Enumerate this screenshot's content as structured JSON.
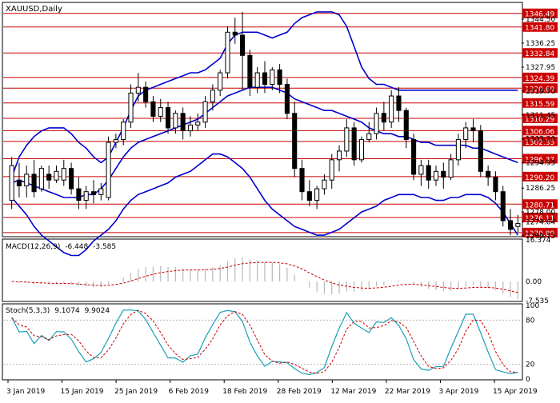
{
  "chart_data": {
    "type": "candlestick",
    "title": "XAUUSD,Daily",
    "x_tick_labels": [
      "3 Jan 2019",
      "15 Jan 2019",
      "25 Jan 2019",
      "6 Feb 2019",
      "18 Feb 2019",
      "28 Feb 2019",
      "12 Mar 2019",
      "22 Mar 2019",
      "3 Apr 2019",
      "15 Apr 2019"
    ],
    "price_axis": {
      "ylim": [
        1269.75,
        1350.0
      ],
      "tick_labels": [
        "1344.50",
        "1336.25",
        "1327.95",
        "1319.70",
        "1311.45",
        "1303.20",
        "1294.95",
        "1286.25",
        "1278.00",
        "1274.64",
        "1269.75"
      ],
      "level_labels": [
        "1346.49",
        "1341.80",
        "1332.84",
        "1324.39",
        "1320.69",
        "1315.59",
        "1310.29",
        "1306.06",
        "1302.33",
        "1296.37",
        "1290.20",
        "1280.71",
        "1276.11",
        "1270.89"
      ]
    },
    "candles": [
      {
        "o": 1282,
        "h": 1297,
        "c": 1294,
        "l": 1279
      },
      {
        "o": 1289,
        "h": 1295,
        "c": 1287,
        "l": 1283
      },
      {
        "o": 1287,
        "h": 1294,
        "c": 1291,
        "l": 1283
      },
      {
        "o": 1291,
        "h": 1296,
        "c": 1285,
        "l": 1283
      },
      {
        "o": 1286,
        "h": 1294,
        "c": 1293,
        "l": 1285
      },
      {
        "o": 1291,
        "h": 1294,
        "c": 1289,
        "l": 1286
      },
      {
        "o": 1289,
        "h": 1294,
        "c": 1292,
        "l": 1288
      },
      {
        "o": 1289,
        "h": 1296,
        "c": 1293,
        "l": 1287
      },
      {
        "o": 1293,
        "h": 1295,
        "c": 1286,
        "l": 1284
      },
      {
        "o": 1286,
        "h": 1290,
        "c": 1282,
        "l": 1279
      },
      {
        "o": 1282,
        "h": 1287,
        "c": 1285,
        "l": 1279
      },
      {
        "o": 1285,
        "h": 1289,
        "c": 1284,
        "l": 1281
      },
      {
        "o": 1284,
        "h": 1288,
        "c": 1286,
        "l": 1282
      },
      {
        "o": 1283,
        "h": 1304,
        "c": 1302,
        "l": 1282
      },
      {
        "o": 1302,
        "h": 1305,
        "c": 1303,
        "l": 1300
      },
      {
        "o": 1303,
        "h": 1310,
        "c": 1309,
        "l": 1301
      },
      {
        "o": 1309,
        "h": 1322,
        "c": 1319,
        "l": 1307
      },
      {
        "o": 1319,
        "h": 1326,
        "c": 1321,
        "l": 1316
      },
      {
        "o": 1321,
        "h": 1323,
        "c": 1316,
        "l": 1314
      },
      {
        "o": 1316,
        "h": 1318,
        "c": 1311,
        "l": 1309
      },
      {
        "o": 1311,
        "h": 1317,
        "c": 1314,
        "l": 1309
      },
      {
        "o": 1314,
        "h": 1316,
        "c": 1307,
        "l": 1305
      },
      {
        "o": 1307,
        "h": 1313,
        "c": 1312,
        "l": 1305
      },
      {
        "o": 1312,
        "h": 1314,
        "c": 1306,
        "l": 1303
      },
      {
        "o": 1306,
        "h": 1311,
        "c": 1308,
        "l": 1304
      },
      {
        "o": 1308,
        "h": 1312,
        "c": 1309,
        "l": 1306
      },
      {
        "o": 1309,
        "h": 1318,
        "c": 1316,
        "l": 1307
      },
      {
        "o": 1316,
        "h": 1322,
        "c": 1320,
        "l": 1313
      },
      {
        "o": 1320,
        "h": 1327,
        "c": 1326,
        "l": 1318
      },
      {
        "o": 1326,
        "h": 1342,
        "c": 1340,
        "l": 1324
      },
      {
        "o": 1340,
        "h": 1345,
        "c": 1339,
        "l": 1336
      },
      {
        "o": 1339,
        "h": 1347,
        "c": 1332,
        "l": 1320
      },
      {
        "o": 1332,
        "h": 1334,
        "c": 1321,
        "l": 1318
      },
      {
        "o": 1321,
        "h": 1328,
        "c": 1326,
        "l": 1319
      },
      {
        "o": 1326,
        "h": 1330,
        "c": 1322,
        "l": 1319
      },
      {
        "o": 1322,
        "h": 1328,
        "c": 1327,
        "l": 1320
      },
      {
        "o": 1327,
        "h": 1329,
        "c": 1322,
        "l": 1319
      },
      {
        "o": 1322,
        "h": 1324,
        "c": 1312,
        "l": 1310
      },
      {
        "o": 1312,
        "h": 1316,
        "c": 1293,
        "l": 1290
      },
      {
        "o": 1293,
        "h": 1296,
        "c": 1285,
        "l": 1282
      },
      {
        "o": 1285,
        "h": 1289,
        "c": 1282,
        "l": 1280
      },
      {
        "o": 1282,
        "h": 1287,
        "c": 1286,
        "l": 1279
      },
      {
        "o": 1286,
        "h": 1291,
        "c": 1289,
        "l": 1284
      },
      {
        "o": 1289,
        "h": 1298,
        "c": 1296,
        "l": 1286
      },
      {
        "o": 1296,
        "h": 1301,
        "c": 1299,
        "l": 1292
      },
      {
        "o": 1299,
        "h": 1310,
        "c": 1307,
        "l": 1297
      },
      {
        "o": 1307,
        "h": 1309,
        "c": 1296,
        "l": 1294
      },
      {
        "o": 1296,
        "h": 1304,
        "c": 1303,
        "l": 1295
      },
      {
        "o": 1303,
        "h": 1309,
        "c": 1305,
        "l": 1302
      },
      {
        "o": 1305,
        "h": 1314,
        "c": 1312,
        "l": 1303
      },
      {
        "o": 1312,
        "h": 1316,
        "c": 1309,
        "l": 1306
      },
      {
        "o": 1309,
        "h": 1320,
        "c": 1318,
        "l": 1307
      },
      {
        "o": 1318,
        "h": 1321,
        "c": 1313,
        "l": 1309
      },
      {
        "o": 1313,
        "h": 1314,
        "c": 1303,
        "l": 1300
      },
      {
        "o": 1303,
        "h": 1305,
        "c": 1291,
        "l": 1289
      },
      {
        "o": 1291,
        "h": 1296,
        "c": 1294,
        "l": 1287
      },
      {
        "o": 1294,
        "h": 1296,
        "c": 1289,
        "l": 1286
      },
      {
        "o": 1289,
        "h": 1294,
        "c": 1292,
        "l": 1287
      },
      {
        "o": 1292,
        "h": 1295,
        "c": 1290,
        "l": 1286
      },
      {
        "o": 1290,
        "h": 1298,
        "c": 1296,
        "l": 1289
      },
      {
        "o": 1296,
        "h": 1305,
        "c": 1303,
        "l": 1294
      },
      {
        "o": 1303,
        "h": 1309,
        "c": 1307,
        "l": 1300
      },
      {
        "o": 1307,
        "h": 1310,
        "c": 1306,
        "l": 1302
      },
      {
        "o": 1306,
        "h": 1308,
        "c": 1292,
        "l": 1290
      },
      {
        "o": 1292,
        "h": 1294,
        "c": 1290,
        "l": 1287
      },
      {
        "o": 1290,
        "h": 1292,
        "c": 1285,
        "l": 1282
      },
      {
        "o": 1285,
        "h": 1287,
        "c": 1275,
        "l": 1273
      },
      {
        "o": 1275,
        "h": 1279,
        "c": 1272,
        "l": 1270
      },
      {
        "o": 1273,
        "h": 1277,
        "c": 1274,
        "l": 1271
      }
    ],
    "bollinger": {
      "upper": [
        1290,
        1297,
        1301,
        1304,
        1306,
        1307,
        1307,
        1307,
        1305,
        1302,
        1300,
        1297,
        1295,
        1297,
        1302,
        1307,
        1313,
        1318,
        1320,
        1321,
        1322,
        1323,
        1324,
        1325,
        1326,
        1326,
        1327,
        1329,
        1331,
        1336,
        1339,
        1340,
        1340,
        1340,
        1339,
        1338,
        1339,
        1340,
        1343,
        1345,
        1346,
        1347,
        1347,
        1347,
        1346,
        1342,
        1335,
        1328,
        1324,
        1322,
        1322,
        1321,
        1320,
        1320,
        1320,
        1320,
        1320,
        1320,
        1320,
        1320,
        1320,
        1320,
        1320,
        1320,
        1320,
        1320,
        1320,
        1320,
        1320
      ],
      "middle": [
        1288,
        1289,
        1288,
        1287,
        1286,
        1285,
        1284,
        1283,
        1283,
        1283,
        1284,
        1284,
        1286,
        1289,
        1293,
        1297,
        1300,
        1302,
        1303,
        1304,
        1305,
        1306,
        1307,
        1308,
        1309,
        1310,
        1312,
        1314,
        1316,
        1318,
        1319,
        1320,
        1321,
        1321,
        1321,
        1321,
        1320,
        1319,
        1317,
        1316,
        1315,
        1314,
        1313,
        1313,
        1312,
        1311,
        1310,
        1309,
        1307,
        1306,
        1305,
        1305,
        1304,
        1304,
        1303,
        1302,
        1302,
        1301,
        1301,
        1301,
        1301,
        1301,
        1300,
        1300,
        1299,
        1298,
        1297,
        1296,
        1295
      ],
      "lower": [
        1283,
        1280,
        1277,
        1273,
        1270,
        1268,
        1266,
        1264,
        1263,
        1263,
        1265,
        1268,
        1270,
        1272,
        1275,
        1279,
        1282,
        1284,
        1285,
        1286,
        1287,
        1288,
        1290,
        1291,
        1292,
        1294,
        1296,
        1298,
        1298,
        1297,
        1295,
        1293,
        1290,
        1286,
        1282,
        1279,
        1277,
        1275,
        1273,
        1272,
        1271,
        1270,
        1270,
        1271,
        1272,
        1274,
        1276,
        1278,
        1279,
        1280,
        1282,
        1283,
        1284,
        1284,
        1284,
        1283,
        1283,
        1282,
        1282,
        1283,
        1283,
        1284,
        1284,
        1284,
        1283,
        1281,
        1278,
        1274,
        1270
      ]
    },
    "macd": {
      "label": "MACD(12,26,9)",
      "macd_value": "-6.448",
      "signal_value": "-3.585",
      "tick_labels": [
        "16.374",
        "0.00",
        "-7.535"
      ],
      "ylim": [
        -7.535,
        16.374
      ]
    },
    "stochastic": {
      "label": "Stoch(5,3,3)",
      "k_value": "9.1074",
      "d_value": "9.9024",
      "tick_labels": [
        "100",
        "80",
        "20",
        "0"
      ],
      "ylim": [
        0,
        100
      ]
    },
    "colors": {
      "candle": "#000000",
      "bollinger": "#0000cc",
      "level_line": "#cc0000",
      "label_bg": "#cc0000",
      "label_text": "#ffffff",
      "macd_histogram": "#b8b8b8",
      "macd_signal": "#cc0000",
      "stoch_main": "#1aa0b8",
      "stoch_signal": "#cc0000"
    }
  }
}
